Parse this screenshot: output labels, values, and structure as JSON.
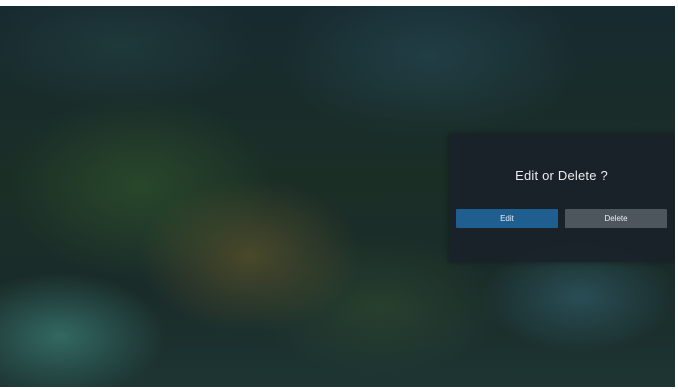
{
  "dialog": {
    "title": "Edit or Delete ?",
    "edit_label": "Edit",
    "delete_label": "Delete"
  },
  "colors": {
    "dialog_background": "#1b2229",
    "edit_button": "#1e5f8f",
    "delete_button": "#4d565c",
    "text": "#e9eef0"
  }
}
